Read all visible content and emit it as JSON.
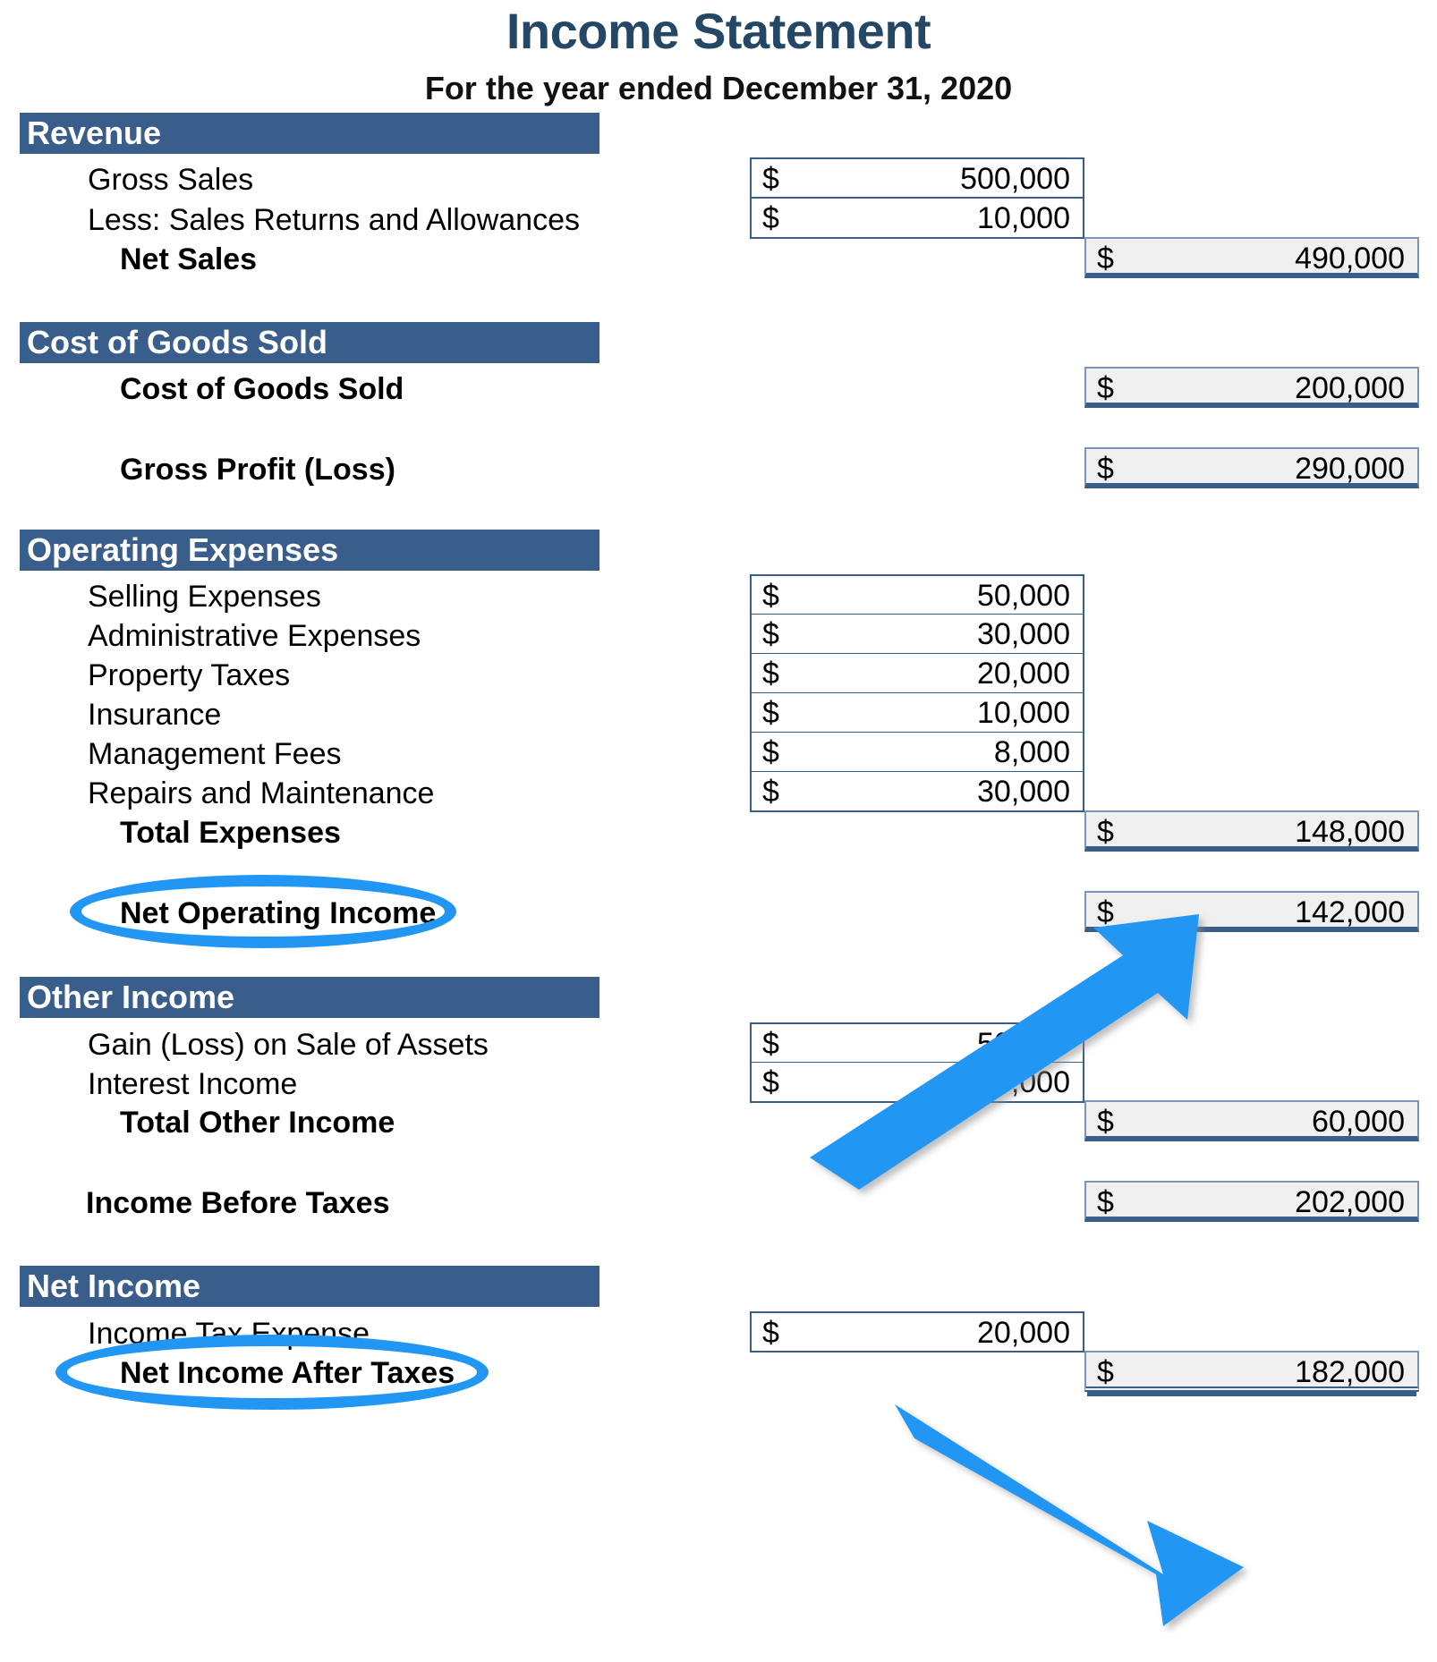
{
  "document": {
    "title": "Income Statement",
    "subtitle": "For the year ended December 31, 2020",
    "currency_symbol": "$"
  },
  "colors": {
    "title_navy": "#234764",
    "header_bar_blue": "#3A5E8C",
    "annotation_blue": "#2196F3",
    "total_fill_grey": "#F0F0F0"
  },
  "sections": {
    "revenue": {
      "header": "Revenue",
      "gross_sales_label": "Gross Sales",
      "gross_sales_value": "500,000",
      "returns_label": "Less: Sales Returns and Allowances",
      "returns_value": "10,000",
      "net_sales_label": "Net Sales",
      "net_sales_value": "490,000"
    },
    "cogs": {
      "header": "Cost of Goods Sold",
      "cogs_label": "Cost of Goods Sold",
      "cogs_value": "200,000",
      "gross_profit_label": "Gross Profit (Loss)",
      "gross_profit_value": "290,000"
    },
    "operating_expenses": {
      "header": "Operating Expenses",
      "selling_label": "Selling Expenses",
      "selling_value": "50,000",
      "admin_label": "Administrative Expenses",
      "admin_value": "30,000",
      "property_label": "Property Taxes",
      "property_value": "20,000",
      "insurance_label": "Insurance",
      "insurance_value": "10,000",
      "management_label": "Management Fees",
      "management_value": "8,000",
      "repairs_label": "Repairs and Maintenance",
      "repairs_value": "30,000",
      "total_expenses_label": "Total Expenses",
      "total_expenses_value": "148,000",
      "net_operating_income_label": "Net Operating Income",
      "net_operating_income_value": "142,000"
    },
    "other_income": {
      "header": "Other Income",
      "gain_label": "Gain (Loss) on Sale of Assets",
      "gain_value": "50,000",
      "interest_label": "Interest Income",
      "interest_value": "10,000",
      "total_other_label": "Total Other Income",
      "total_other_value": "60,000",
      "income_before_taxes_label": "Income Before Taxes",
      "income_before_taxes_value": "202,000"
    },
    "net_income": {
      "header": "Net Income",
      "tax_label": "Income Tax Expense",
      "tax_value": "20,000",
      "net_income_after_taxes_label": "Net Income After Taxes",
      "net_income_after_taxes_value": "182,000"
    }
  },
  "annotations": {
    "ellipse_net_operating_income": "Net Operating Income",
    "ellipse_net_income_after_taxes": "Net Income After Taxes",
    "arrow_to_net_operating_income": "142,000",
    "arrow_to_net_income_after_taxes": "182,000"
  }
}
